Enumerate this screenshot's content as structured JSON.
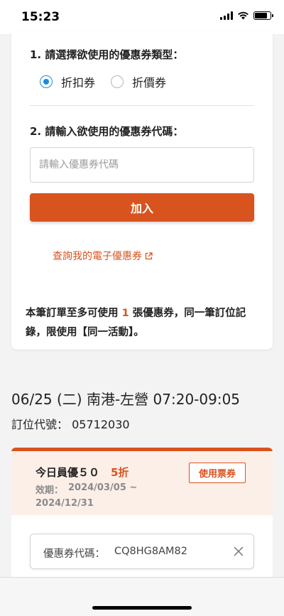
{
  "status_bar": {
    "time": "15:23",
    "icons": [
      "signal-icon",
      "wifi-icon",
      "battery-icon"
    ]
  },
  "coupon_form": {
    "type_heading": "1. 請選擇欲使用的優惠券類型：",
    "type_options": [
      {
        "label": "折扣券",
        "selected": true
      },
      {
        "label": "折價券",
        "selected": false
      }
    ],
    "code_heading": "2. 請輸入欲使用的優惠券代碼：",
    "code_input": {
      "value": "",
      "placeholder": "請輸入優惠券代碼"
    },
    "add_button": "加入",
    "query_link": "查詢我的電子優惠券",
    "notice": {
      "prefix": "本筆訂單至多可使用",
      "count": "1",
      "suffix": "張優惠券，同一筆訂位記錄，限使用【同一活動】。"
    }
  },
  "trip": {
    "title": "06/25 (二) 南港-左營 07:20-09:05",
    "booking_label": "訂位代號：",
    "booking_code": "05712030"
  },
  "coupon_card": {
    "name": "今日員優５０",
    "discount": "5折",
    "validity_label": "效期：",
    "validity_start": "2024/03/05 ~",
    "validity_end": "2024/12/31",
    "use_button": "使用票券",
    "applied_code_label": "優惠券代碼：",
    "applied_code_value": "CQ8HG8AM82"
  },
  "colors": {
    "accent": "#d9531e",
    "radio_selected": "#1a8fd8",
    "page_background": "#f3f3f4",
    "coupon_header_background": "#fcefe8"
  }
}
